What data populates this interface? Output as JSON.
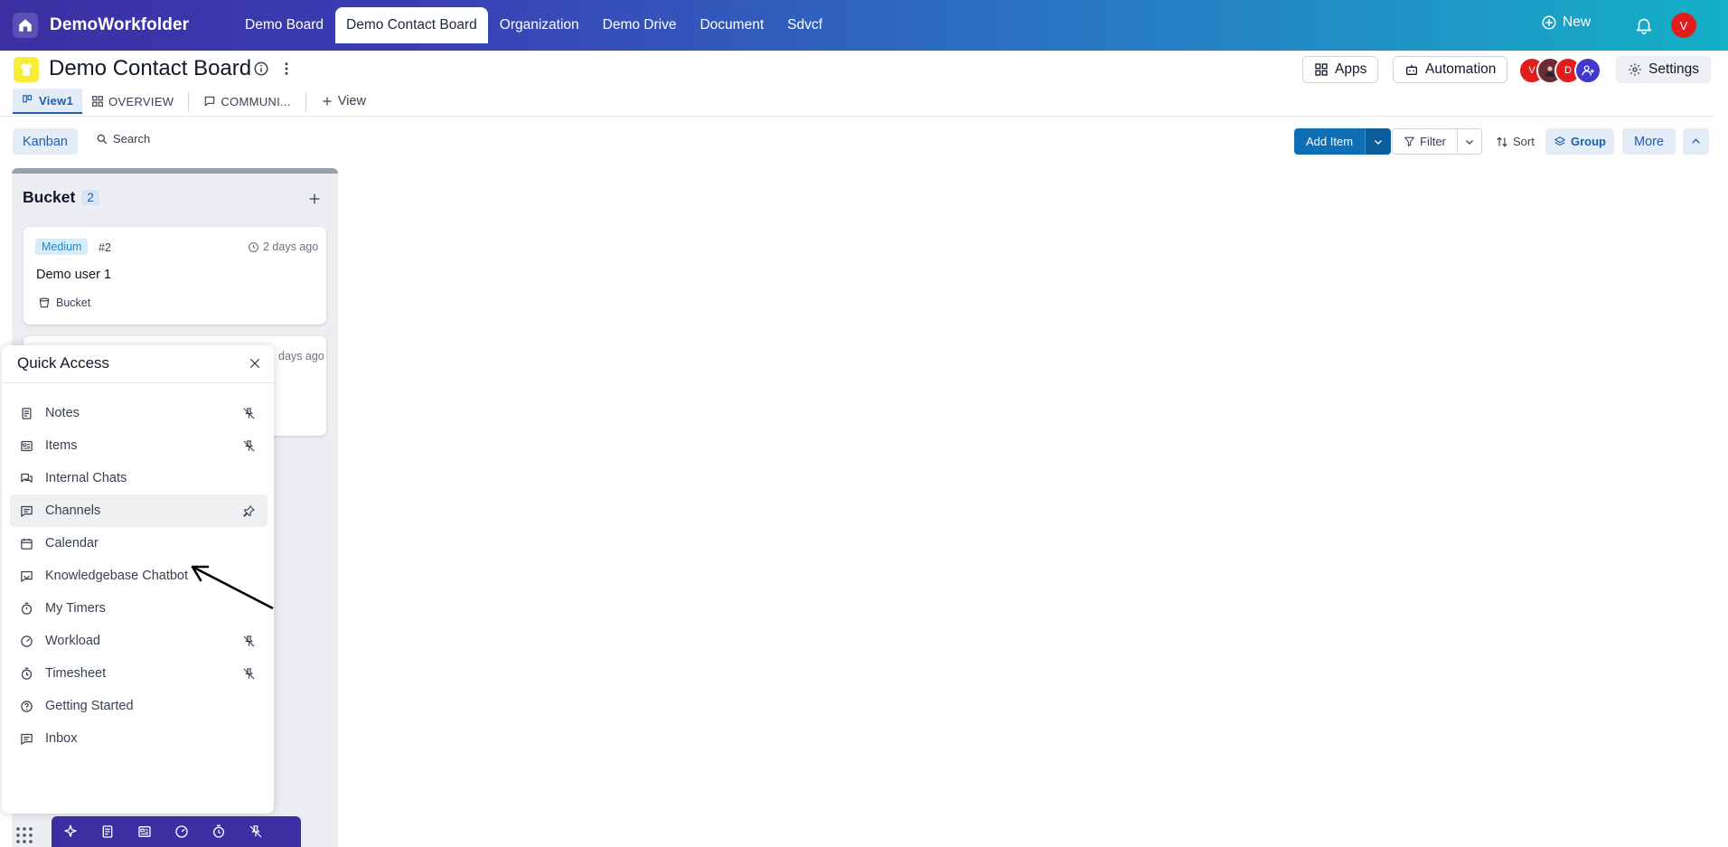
{
  "topbar": {
    "brand": "DemoWorkfolder",
    "tabs": [
      {
        "label": "Demo Board"
      },
      {
        "label": "Demo Contact Board",
        "active": true
      },
      {
        "label": "Organization"
      },
      {
        "label": "Demo Drive"
      },
      {
        "label": "Document"
      },
      {
        "label": "Sdvcf"
      }
    ],
    "new_label": "New",
    "avatar_initial": "V"
  },
  "board": {
    "title": "Demo Contact Board",
    "apps_label": "Apps",
    "automation_label": "Automation",
    "settings_label": "Settings",
    "members": [
      {
        "initial": "V",
        "color": "#e11d1d"
      },
      {
        "initial": "",
        "color": "#6b2a35"
      },
      {
        "initial": "D",
        "color": "#e11d1d"
      }
    ]
  },
  "views": {
    "tabs": [
      {
        "label": "View1",
        "icon": "kanban-icon",
        "active": true
      },
      {
        "label": "OVERVIEW",
        "icon": "dashboard-icon"
      },
      {
        "label": "COMMUNI...",
        "icon": "chat-icon"
      }
    ],
    "add_view_label": "View"
  },
  "toolbar": {
    "kanban_label": "Kanban",
    "search_label": "Search",
    "add_item_label": "Add Item",
    "filter_label": "Filter",
    "sort_label": "Sort",
    "group_label": "Group",
    "more_label": "More"
  },
  "column": {
    "title": "Bucket",
    "count": "2",
    "cards": [
      {
        "priority": "Medium",
        "id": "#2",
        "time": "2 days ago",
        "name": "Demo user 1",
        "bucket": "Bucket"
      },
      {
        "time": "days ago"
      }
    ]
  },
  "quick_access": {
    "title": "Quick Access",
    "items": [
      {
        "label": "Notes",
        "icon": "notes-icon",
        "pin": "unpinned"
      },
      {
        "label": "Items",
        "icon": "items-icon",
        "pin": "unpinned"
      },
      {
        "label": "Internal Chats",
        "icon": "internal-chats-icon",
        "pin": "none"
      },
      {
        "label": "Channels",
        "icon": "channels-icon",
        "pin": "pinned",
        "hover": true
      },
      {
        "label": "Calendar",
        "icon": "calendar-icon",
        "pin": "none"
      },
      {
        "label": "Knowledgebase Chatbot",
        "icon": "chatbot-icon",
        "pin": "none"
      },
      {
        "label": "My Timers",
        "icon": "timer-icon",
        "pin": "none"
      },
      {
        "label": "Workload",
        "icon": "workload-icon",
        "pin": "unpinned"
      },
      {
        "label": "Timesheet",
        "icon": "timesheet-icon",
        "pin": "unpinned"
      },
      {
        "label": "Getting Started",
        "icon": "help-icon",
        "pin": "none"
      },
      {
        "label": "Inbox",
        "icon": "inbox-icon",
        "pin": "none"
      }
    ]
  },
  "dock": {
    "items": [
      "ai-sparkle-icon",
      "notes-icon",
      "items-icon",
      "workload-icon",
      "timer-icon",
      "unpin-icon"
    ]
  },
  "colors": {
    "accent": "#1e5fae",
    "primary_button": "#0f6fb6",
    "dock": "#3b2fa3",
    "board_icon": "#f4ee3a"
  }
}
